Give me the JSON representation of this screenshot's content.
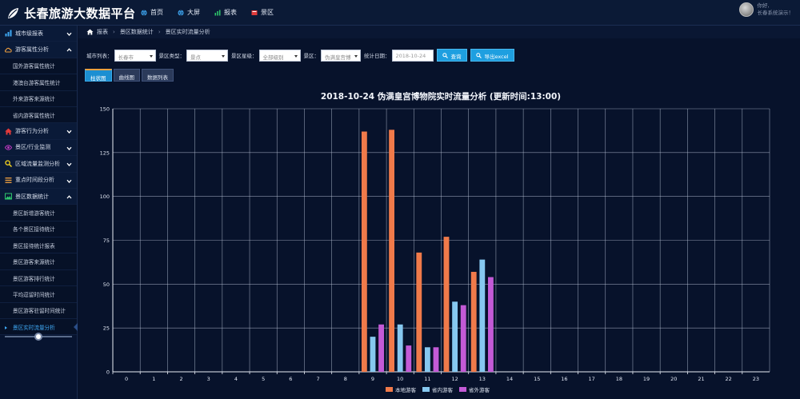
{
  "app": {
    "title": "长春旅游大数据平台",
    "nav": [
      {
        "label": "首页",
        "icon": "globe-icon"
      },
      {
        "label": "大屏",
        "icon": "globe-icon"
      },
      {
        "label": "报表",
        "icon": "bar-chart-icon"
      },
      {
        "label": "景区",
        "icon": "dashboard-icon"
      }
    ],
    "user": {
      "greeting": "你好,",
      "name": "长春系统演示！"
    }
  },
  "sidebar": {
    "items": [
      {
        "type": "section",
        "label": "城市级报表",
        "icon": "bar-chart-icon",
        "icon_color": "#3fa9f5",
        "chevron": "down"
      },
      {
        "type": "section",
        "label": "游客属性分析",
        "icon": "cloud-icon",
        "icon_color": "#f0a040",
        "chevron": "up"
      },
      {
        "type": "sub",
        "label": "国外游客属性统计"
      },
      {
        "type": "sub",
        "label": "港澳台游客属性统计"
      },
      {
        "type": "sub",
        "label": "外来游客来源统计"
      },
      {
        "type": "sub",
        "label": "省内游客属性统计"
      },
      {
        "type": "section",
        "label": "游客行为分析",
        "icon": "home-icon",
        "icon_color": "#e23a3a",
        "chevron": "down"
      },
      {
        "type": "section",
        "label": "景区/行业监测",
        "icon": "eye-icon",
        "icon_color": "#c23ac2",
        "chevron": "down"
      },
      {
        "type": "section",
        "label": "区域流量监测分析",
        "icon": "search-icon",
        "icon_color": "#f5d21e",
        "chevron": "down"
      },
      {
        "type": "section",
        "label": "重点时间段分析",
        "icon": "list-icon",
        "icon_color": "#f0a040",
        "chevron": "down"
      },
      {
        "type": "section",
        "label": "景区数据统计",
        "icon": "image-icon",
        "icon_color": "#2ec46b",
        "chevron": "up"
      },
      {
        "type": "sub",
        "label": "景区新增游客统计"
      },
      {
        "type": "sub",
        "label": "各个景区接待统计"
      },
      {
        "type": "sub",
        "label": "景区接待统计报表"
      },
      {
        "type": "sub",
        "label": "景区游客来源统计"
      },
      {
        "type": "sub",
        "label": "景区游客排行统计"
      },
      {
        "type": "sub",
        "label": "平均逗留时间统计"
      },
      {
        "type": "sub",
        "label": "景区游客驻留时间统计"
      },
      {
        "type": "sub",
        "label": "景区实时流量分析",
        "active": true
      }
    ],
    "slider_value": 0.5
  },
  "breadcrumb": [
    "报表",
    "景区数据统计",
    "景区实时流量分析"
  ],
  "filters": {
    "city_label": "城市列表：",
    "city_value": "长春市",
    "type_label": "景区类型：",
    "type_value": "景点",
    "level_label": "景区星级：",
    "level_value": "全部级别",
    "spot_label": "景区：",
    "spot_value": "伪满皇宫博",
    "date_label": "统计日期：",
    "date_value": "2018-10-24",
    "query_label": "查询",
    "export_label": "导出excel"
  },
  "tabs": [
    {
      "label": "柱状图",
      "active": true
    },
    {
      "label": "曲线图",
      "active": false
    },
    {
      "label": "数据列表",
      "active": false
    }
  ],
  "chart_data": {
    "type": "bar",
    "title": "2018-10-24 伪满皇宫博物院实时流量分析 (更新时间:13:00)",
    "categories": [
      "0",
      "1",
      "2",
      "3",
      "4",
      "5",
      "6",
      "7",
      "8",
      "9",
      "10",
      "11",
      "12",
      "13",
      "14",
      "15",
      "16",
      "17",
      "18",
      "19",
      "20",
      "21",
      "22",
      "23"
    ],
    "series": [
      {
        "name": "本地游客",
        "color": "#f07a4a",
        "values": [
          0,
          0,
          0,
          0,
          0,
          0,
          0,
          0,
          0,
          137,
          138,
          68,
          77,
          57,
          0,
          0,
          0,
          0,
          0,
          0,
          0,
          0,
          0,
          0
        ]
      },
      {
        "name": "省内游客",
        "color": "#86c8f0",
        "values": [
          0,
          0,
          0,
          0,
          0,
          0,
          0,
          0,
          0,
          20,
          27,
          14,
          40,
          64,
          0,
          0,
          0,
          0,
          0,
          0,
          0,
          0,
          0,
          0
        ]
      },
      {
        "name": "省外游客",
        "color": "#c35ad6",
        "values": [
          0,
          0,
          0,
          0,
          0,
          0,
          0,
          0,
          0,
          27,
          15,
          14,
          38,
          54,
          0,
          0,
          0,
          0,
          0,
          0,
          0,
          0,
          0,
          0
        ]
      }
    ],
    "ylim": [
      0,
      150
    ],
    "yticks": [
      0,
      25,
      50,
      75,
      100,
      125,
      150
    ],
    "grid": true,
    "legend": "bottom-center"
  }
}
